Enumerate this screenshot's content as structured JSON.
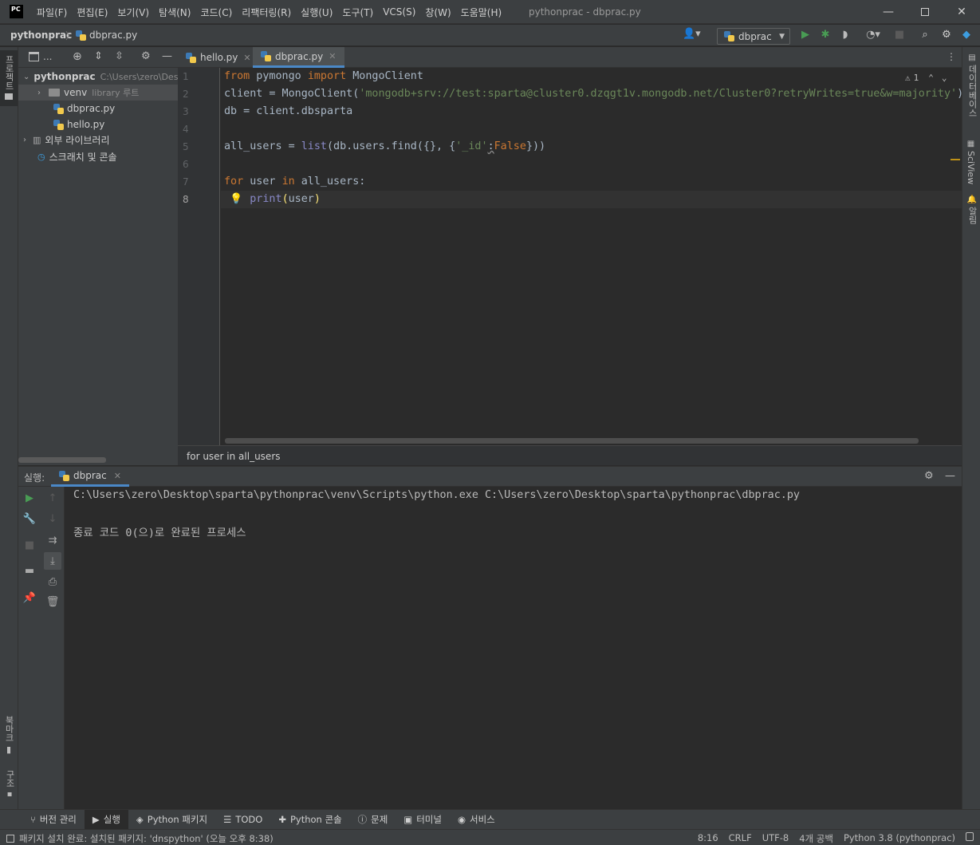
{
  "menu": [
    "파일(F)",
    "편집(E)",
    "보기(V)",
    "탐색(N)",
    "코드(C)",
    "리팩터링(R)",
    "실행(U)",
    "도구(T)",
    "VCS(S)",
    "창(W)",
    "도움말(H)"
  ],
  "window_title": "pythonprac - dbprac.py",
  "breadcrumb": {
    "project": "pythonprac",
    "file": "dbprac.py"
  },
  "run_config": "dbprac",
  "left_strip": {
    "project_label": "프로젝트",
    "bookmarks_label": "북마크",
    "structure_label": "구조"
  },
  "right_strip": {
    "database_label": "데이터베이스",
    "sciview_label": "SciView",
    "notifications_label": "알림"
  },
  "project_panel": {
    "header_short": "...",
    "root_name": "pythonprac",
    "root_path": "C:\\Users\\zero\\Deskt",
    "venv": "venv",
    "venv_hint": "library 루트",
    "files": [
      "dbprac.py",
      "hello.py"
    ],
    "external_libs": "외부 라이브러리",
    "scratches": "스크래치 및 콘솔"
  },
  "tabs": [
    {
      "label": "hello.py"
    },
    {
      "label": "dbprac.py"
    }
  ],
  "line_numbers": [
    "1",
    "2",
    "3",
    "4",
    "5",
    "6",
    "7",
    "8"
  ],
  "inspection": "1",
  "code_breadcrumb": "for user in all_users",
  "run_panel": {
    "title": "실행:",
    "tab": "dbprac",
    "command": "C:\\Users\\zero\\Desktop\\sparta\\pythonprac\\venv\\Scripts\\python.exe C:\\Users\\zero\\Desktop\\sparta\\pythonprac\\dbprac.py",
    "exit_message": "종료 코드 0(으)로 완료된 프로세스"
  },
  "toolwindows": [
    "버전 관리",
    "실행",
    "Python 패키지",
    "TODO",
    "Python 콘솔",
    "문제",
    "터미널",
    "서비스"
  ],
  "status": {
    "message": "패키지 설치 완료: 설치된 패키지: 'dnspython' (오늘 오후 8:38)",
    "position": "8:16",
    "line_sep": "CRLF",
    "encoding": "UTF-8",
    "indent": "4개 공백",
    "interpreter": "Python 3.8 (pythonprac)"
  },
  "colors": {
    "accent": "#4a88c7",
    "run_green": "#499c54",
    "keyword": "#cc7832",
    "string": "#6a8759"
  }
}
